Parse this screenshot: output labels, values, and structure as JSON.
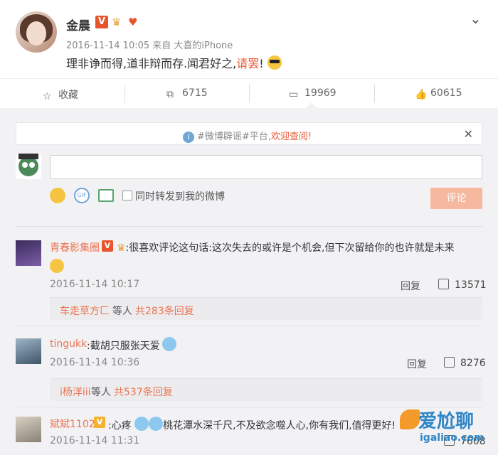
{
  "post": {
    "author": "金晨",
    "verified": "V",
    "meta": "2016-11-14 10:05 来自 大喜的iPhone",
    "text_main": "理非诤而得,道非辩而存.闻君好之,",
    "text_red": "请罢",
    "text_end": "!"
  },
  "actions": {
    "favorite": "收藏",
    "repost": "6715",
    "comment": "19969",
    "like": "60615"
  },
  "notice": {
    "text": "#微博辟谣#平台,",
    "link": "欢迎查阅!"
  },
  "composer": {
    "repost_label": "同时转发到我的微博",
    "submit": "评论"
  },
  "comments": [
    {
      "name": "青春影集圈",
      "verified": "V",
      "text": ":很喜欢评论这句话:这次失去的或许是个机会,但下次留给你的也许就是未来",
      "time": "2016-11-14 10:17",
      "reply": "回复",
      "likes": "13571",
      "sub_user": "车走草方匚",
      "sub_mid": "等人",
      "sub_count": "共283条回复"
    },
    {
      "name": "tingukk",
      "text": ":截胡只服张天爱",
      "time": "2016-11-14 10:36",
      "reply": "回复",
      "likes": "8276",
      "sub_user": "i杨洋iii",
      "sub_mid": "等人",
      "sub_count": "共537条回复"
    },
    {
      "name": "斌斌1102",
      "verified": "V",
      "text_a": ":心疼",
      "text_b": "桃花潭水深千尺,不及欲念噬人心,你有我们,值得更好!",
      "time": "2016-11-14 11:31",
      "likes": "7608"
    }
  ],
  "watermark": {
    "title": "爱尬聊",
    "url": "igaliao.com"
  }
}
